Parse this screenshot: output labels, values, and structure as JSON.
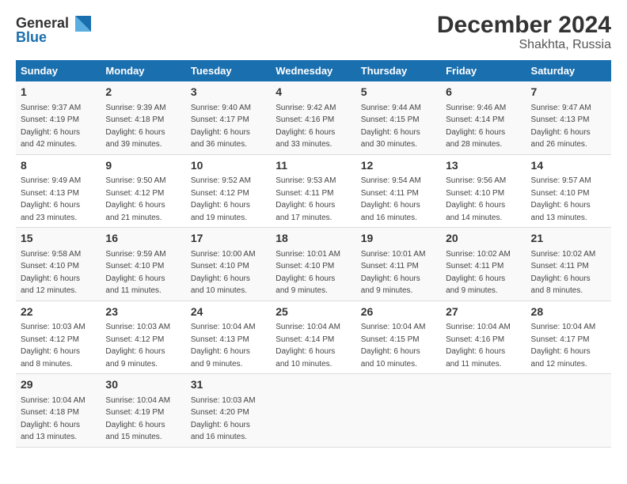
{
  "header": {
    "logo_line1": "General",
    "logo_line2": "Blue",
    "title": "December 2024",
    "subtitle": "Shakhta, Russia"
  },
  "days_of_week": [
    "Sunday",
    "Monday",
    "Tuesday",
    "Wednesday",
    "Thursday",
    "Friday",
    "Saturday"
  ],
  "weeks": [
    [
      {
        "day": "1",
        "info": "Sunrise: 9:37 AM\nSunset: 4:19 PM\nDaylight: 6 hours\nand 42 minutes."
      },
      {
        "day": "2",
        "info": "Sunrise: 9:39 AM\nSunset: 4:18 PM\nDaylight: 6 hours\nand 39 minutes."
      },
      {
        "day": "3",
        "info": "Sunrise: 9:40 AM\nSunset: 4:17 PM\nDaylight: 6 hours\nand 36 minutes."
      },
      {
        "day": "4",
        "info": "Sunrise: 9:42 AM\nSunset: 4:16 PM\nDaylight: 6 hours\nand 33 minutes."
      },
      {
        "day": "5",
        "info": "Sunrise: 9:44 AM\nSunset: 4:15 PM\nDaylight: 6 hours\nand 30 minutes."
      },
      {
        "day": "6",
        "info": "Sunrise: 9:46 AM\nSunset: 4:14 PM\nDaylight: 6 hours\nand 28 minutes."
      },
      {
        "day": "7",
        "info": "Sunrise: 9:47 AM\nSunset: 4:13 PM\nDaylight: 6 hours\nand 26 minutes."
      }
    ],
    [
      {
        "day": "8",
        "info": "Sunrise: 9:49 AM\nSunset: 4:13 PM\nDaylight: 6 hours\nand 23 minutes."
      },
      {
        "day": "9",
        "info": "Sunrise: 9:50 AM\nSunset: 4:12 PM\nDaylight: 6 hours\nand 21 minutes."
      },
      {
        "day": "10",
        "info": "Sunrise: 9:52 AM\nSunset: 4:12 PM\nDaylight: 6 hours\nand 19 minutes."
      },
      {
        "day": "11",
        "info": "Sunrise: 9:53 AM\nSunset: 4:11 PM\nDaylight: 6 hours\nand 17 minutes."
      },
      {
        "day": "12",
        "info": "Sunrise: 9:54 AM\nSunset: 4:11 PM\nDaylight: 6 hours\nand 16 minutes."
      },
      {
        "day": "13",
        "info": "Sunrise: 9:56 AM\nSunset: 4:10 PM\nDaylight: 6 hours\nand 14 minutes."
      },
      {
        "day": "14",
        "info": "Sunrise: 9:57 AM\nSunset: 4:10 PM\nDaylight: 6 hours\nand 13 minutes."
      }
    ],
    [
      {
        "day": "15",
        "info": "Sunrise: 9:58 AM\nSunset: 4:10 PM\nDaylight: 6 hours\nand 12 minutes."
      },
      {
        "day": "16",
        "info": "Sunrise: 9:59 AM\nSunset: 4:10 PM\nDaylight: 6 hours\nand 11 minutes."
      },
      {
        "day": "17",
        "info": "Sunrise: 10:00 AM\nSunset: 4:10 PM\nDaylight: 6 hours\nand 10 minutes."
      },
      {
        "day": "18",
        "info": "Sunrise: 10:01 AM\nSunset: 4:10 PM\nDaylight: 6 hours\nand 9 minutes."
      },
      {
        "day": "19",
        "info": "Sunrise: 10:01 AM\nSunset: 4:11 PM\nDaylight: 6 hours\nand 9 minutes."
      },
      {
        "day": "20",
        "info": "Sunrise: 10:02 AM\nSunset: 4:11 PM\nDaylight: 6 hours\nand 9 minutes."
      },
      {
        "day": "21",
        "info": "Sunrise: 10:02 AM\nSunset: 4:11 PM\nDaylight: 6 hours\nand 8 minutes."
      }
    ],
    [
      {
        "day": "22",
        "info": "Sunrise: 10:03 AM\nSunset: 4:12 PM\nDaylight: 6 hours\nand 8 minutes."
      },
      {
        "day": "23",
        "info": "Sunrise: 10:03 AM\nSunset: 4:12 PM\nDaylight: 6 hours\nand 9 minutes."
      },
      {
        "day": "24",
        "info": "Sunrise: 10:04 AM\nSunset: 4:13 PM\nDaylight: 6 hours\nand 9 minutes."
      },
      {
        "day": "25",
        "info": "Sunrise: 10:04 AM\nSunset: 4:14 PM\nDaylight: 6 hours\nand 10 minutes."
      },
      {
        "day": "26",
        "info": "Sunrise: 10:04 AM\nSunset: 4:15 PM\nDaylight: 6 hours\nand 10 minutes."
      },
      {
        "day": "27",
        "info": "Sunrise: 10:04 AM\nSunset: 4:16 PM\nDaylight: 6 hours\nand 11 minutes."
      },
      {
        "day": "28",
        "info": "Sunrise: 10:04 AM\nSunset: 4:17 PM\nDaylight: 6 hours\nand 12 minutes."
      }
    ],
    [
      {
        "day": "29",
        "info": "Sunrise: 10:04 AM\nSunset: 4:18 PM\nDaylight: 6 hours\nand 13 minutes."
      },
      {
        "day": "30",
        "info": "Sunrise: 10:04 AM\nSunset: 4:19 PM\nDaylight: 6 hours\nand 15 minutes."
      },
      {
        "day": "31",
        "info": "Sunrise: 10:03 AM\nSunset: 4:20 PM\nDaylight: 6 hours\nand 16 minutes."
      },
      {
        "day": "",
        "info": ""
      },
      {
        "day": "",
        "info": ""
      },
      {
        "day": "",
        "info": ""
      },
      {
        "day": "",
        "info": ""
      }
    ]
  ]
}
